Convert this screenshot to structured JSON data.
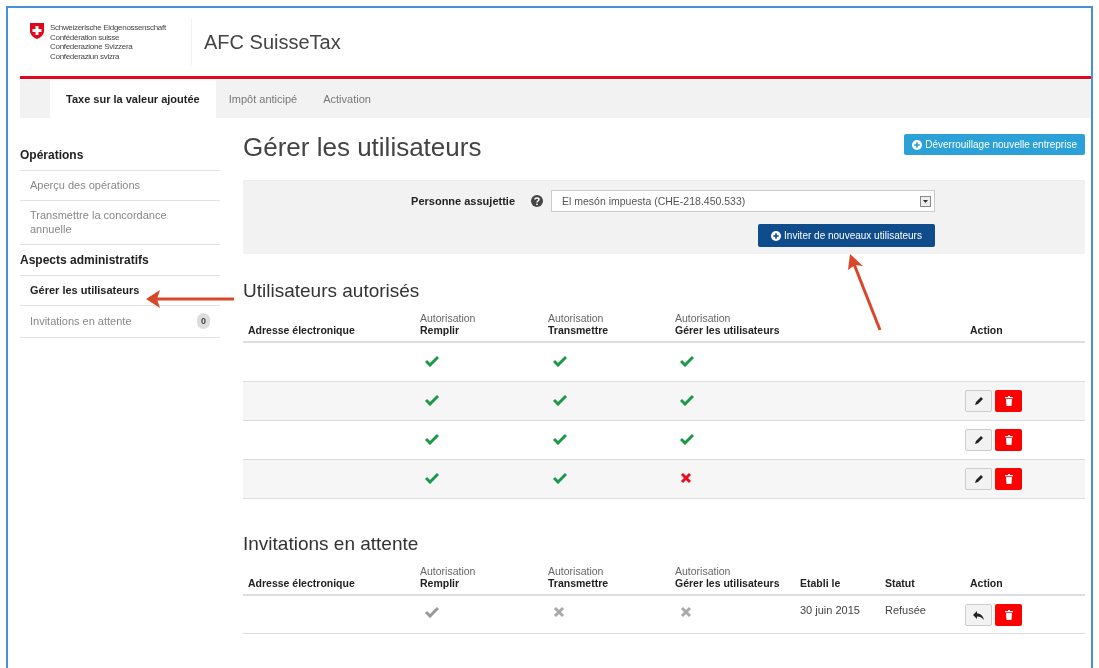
{
  "header": {
    "emblem_lines": [
      "Schweizerische Eidgenossenschaft",
      "Confédération suisse",
      "Confederazione Svizzera",
      "Confederaziun svizra"
    ],
    "app_title": "AFC SuisseTax"
  },
  "nav_tabs": [
    {
      "label": "Taxe sur la valeur ajoutée",
      "selected": true
    },
    {
      "label": "Impôt anticipé",
      "selected": false
    },
    {
      "label": "Activation",
      "selected": false
    }
  ],
  "sidebar": {
    "sections": [
      {
        "title": "Opérations",
        "items": [
          {
            "label": "Aperçu des opérations",
            "selected": false
          },
          {
            "label": "Transmettre la concordance annuelle",
            "selected": false
          }
        ]
      },
      {
        "title": "Aspects administratifs",
        "items": [
          {
            "label": "Gérer les utilisateurs",
            "selected": true
          },
          {
            "label": "Invitations en attente",
            "selected": false,
            "badge": "0"
          }
        ]
      }
    ]
  },
  "page_title": "Gérer les utilisateurs",
  "unlock_button": "Déverrouillage nouvelle entreprise",
  "filter": {
    "label": "Personne assujettie",
    "value": "El mesón impuesta (CHE-218.450.533)",
    "invite_button": "Inviter de nouveaux utilisateurs"
  },
  "tables": [
    {
      "kind": "authorized",
      "title": "Utilisateurs autorisés",
      "columns": [
        {
          "label": "Adresse électronique"
        },
        {
          "caption": "Autorisation",
          "label": "Remplir"
        },
        {
          "caption": "Autorisation",
          "label": "Transmettre"
        },
        {
          "caption": "Autorisation",
          "label": "Gérer les utilisateurs"
        },
        {
          "label": "Action"
        }
      ],
      "rows": [
        {
          "permissions": [
            true,
            true,
            true
          ]
        },
        {
          "permissions": [
            true,
            true,
            true
          ],
          "actions": [
            {
              "kind": "edit"
            },
            {
              "kind": "delete"
            }
          ]
        },
        {
          "permissions": [
            true,
            true,
            true
          ],
          "actions": [
            {
              "kind": "edit"
            },
            {
              "kind": "delete"
            }
          ]
        },
        {
          "permissions": [
            true,
            true,
            false
          ],
          "actions": [
            {
              "kind": "edit"
            },
            {
              "kind": "delete"
            }
          ]
        }
      ]
    },
    {
      "kind": "pending",
      "title": "Invitations en attente",
      "columns": [
        {
          "label": "Adresse électronique"
        },
        {
          "caption": "Autorisation",
          "label": "Remplir"
        },
        {
          "caption": "Autorisation",
          "label": "Transmettre"
        },
        {
          "caption": "Autorisation",
          "label": "Gérer les utilisateurs"
        },
        {
          "label": "Etabli le"
        },
        {
          "label": "Statut"
        },
        {
          "label": "Action"
        }
      ],
      "rows": [
        {
          "permissions": [
            true,
            false,
            false
          ],
          "established": "30 juin 2015",
          "status": "Refusée",
          "actions": [
            {
              "kind": "reply"
            },
            {
              "kind": "delete"
            }
          ]
        }
      ]
    }
  ]
}
